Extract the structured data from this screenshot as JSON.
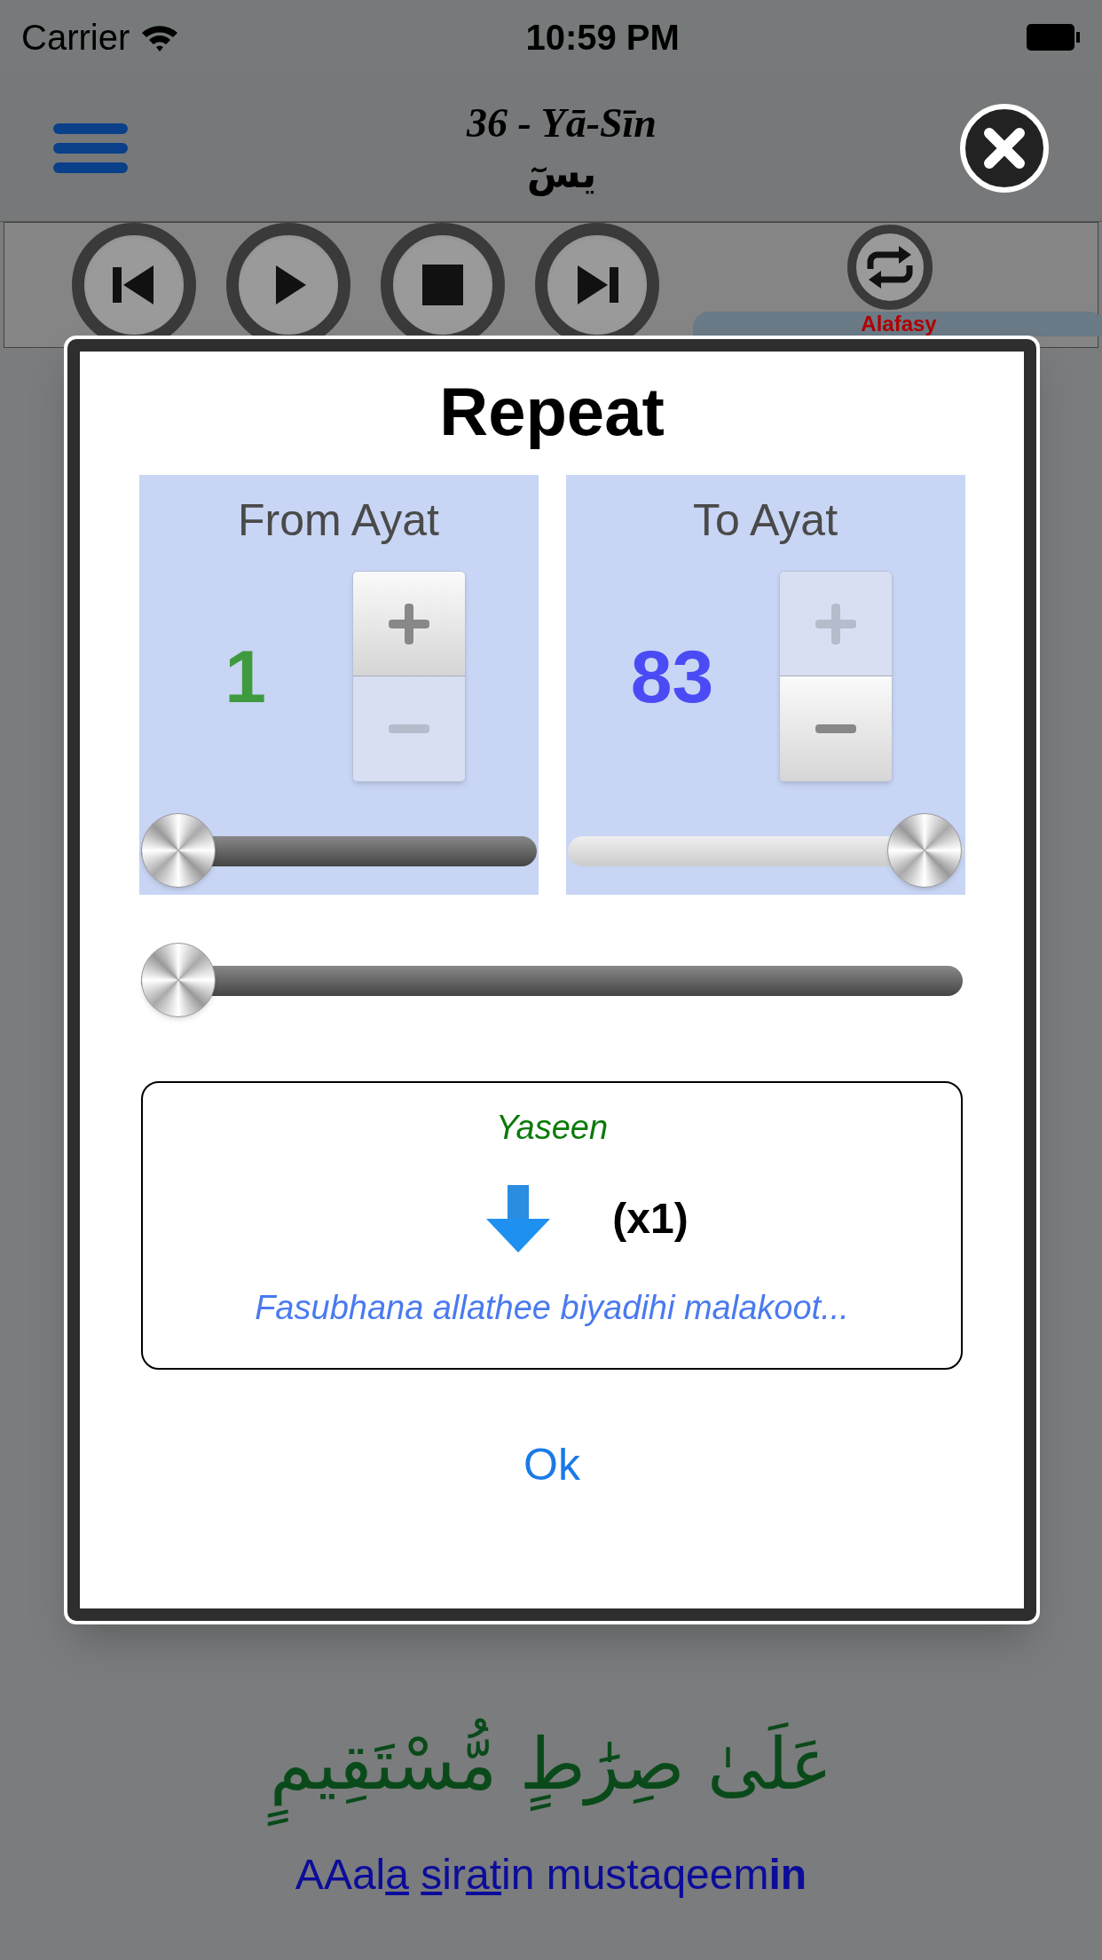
{
  "status_bar": {
    "carrier": "Carrier",
    "time": "10:59 PM"
  },
  "nav_bar": {
    "title": "36 - Yā-Sīn",
    "subtitle": "يسٓ"
  },
  "player": {
    "buttons": [
      {
        "kind": "previous"
      },
      {
        "kind": "play"
      },
      {
        "kind": "stop"
      },
      {
        "kind": "next"
      }
    ],
    "repeat_button": {
      "kind": "repeat"
    },
    "reciter": "Alafasy"
  },
  "verse": {
    "arabic": "عَلَىٰ صِرَٰطٍ مُّسْتَقِيمٍ",
    "transliteration": [
      {
        "text": "AAal",
        "underlined": false
      },
      {
        "text": "a ",
        "underlined": true
      },
      {
        "text": "s",
        "underlined": true
      },
      {
        "text": "ir",
        "underlined": false
      },
      {
        "text": "at",
        "underlined": true
      },
      {
        "text": "in mustaqeem**in**",
        "underlined": false
      }
    ]
  },
  "dialog": {
    "title": "Repeat",
    "ranges": [
      {
        "label": "From Ayat",
        "value": "1",
        "color": "#3f9a3f",
        "plus_disabled": false,
        "minus_disabled": true,
        "level": 0
      },
      {
        "label": "To Ayat",
        "value": "83",
        "color": "#4b4bf5",
        "plus_disabled": true,
        "minus_disabled": false,
        "level": 1
      }
    ],
    "count_slider": {
      "level": 0
    },
    "summary": {
      "surah": "Yaseen",
      "count": "(x1)",
      "verse_text": "Fasubhana allathee biyadihi malakoot..."
    },
    "ok_button": "Ok"
  }
}
